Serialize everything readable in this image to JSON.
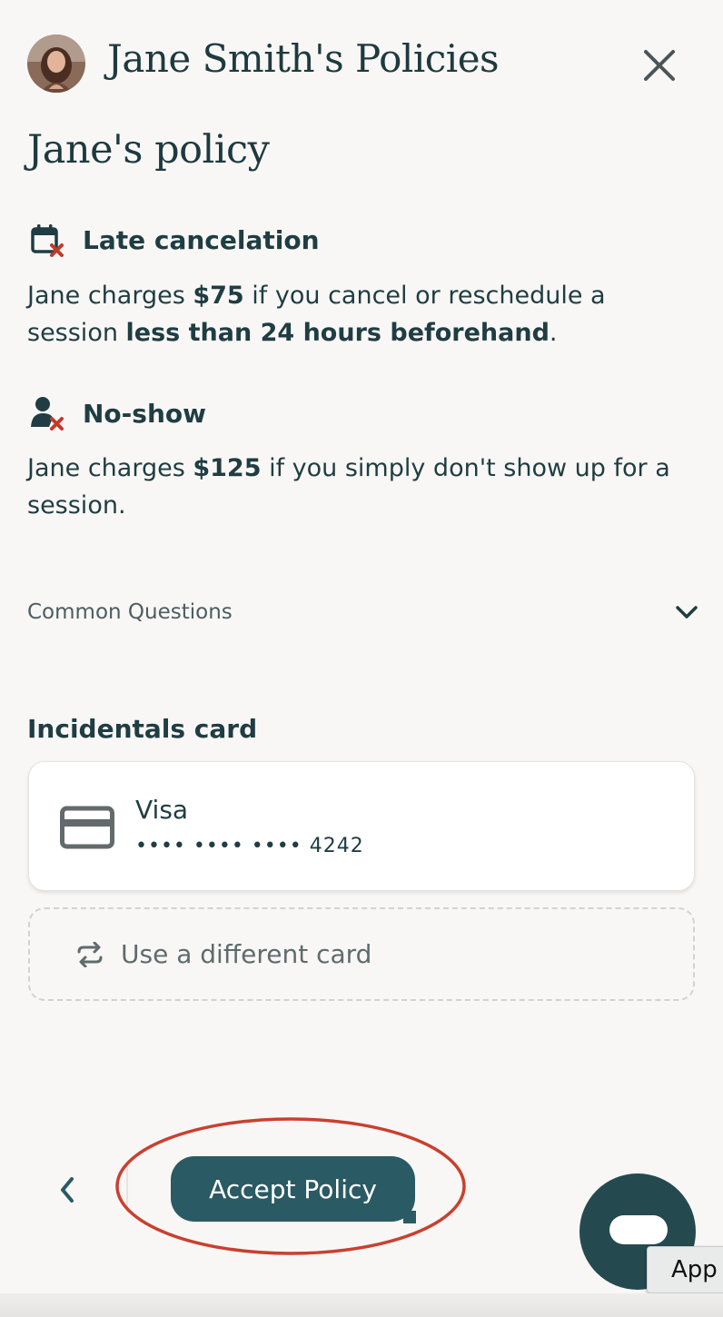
{
  "header": {
    "title": "Jane Smith's Policies"
  },
  "policy": {
    "heading": "Jane's policy",
    "late_cancelation": {
      "title": "Late cancelation",
      "text_1": "Jane charges ",
      "amount": "$75",
      "text_2": " if you cancel or reschedule a session ",
      "emphasis": "less than 24 hours beforehand",
      "text_3": "."
    },
    "no_show": {
      "title": "No-show",
      "text_1": "Jane charges ",
      "amount": "$125",
      "text_2": " if you simply don't show up for a session."
    },
    "faq_label": "Common Questions"
  },
  "incidentals": {
    "title": "Incidentals card",
    "card_brand": "Visa",
    "card_number": "•••• •••• •••• 4242",
    "different_card_label": "Use a different card"
  },
  "footer": {
    "accept_label": "Accept Policy",
    "app_tag": "App"
  },
  "colors": {
    "primary": "#2a5a63",
    "text": "#1f3d42",
    "alert_x": "#c0392b",
    "annotation_circle": "#c9402f",
    "background": "#f8f7f5"
  }
}
